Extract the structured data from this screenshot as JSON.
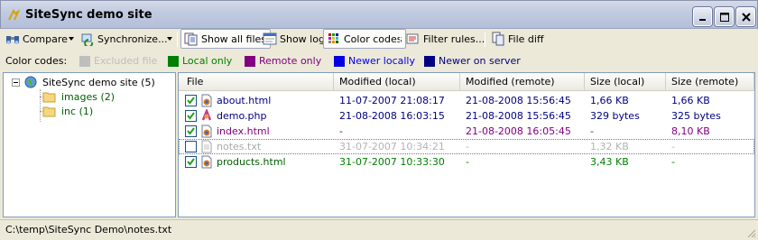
{
  "window": {
    "title": "SiteSync demo site"
  },
  "toolbar": {
    "compare": "Compare",
    "synchronize": "Synchronize...",
    "show_all_files": "Show all files",
    "show_log": "Show log",
    "color_codes": "Color codes",
    "filter_rules": "Filter rules...",
    "file_diff": "File diff"
  },
  "color_codes": {
    "label": "Color codes:",
    "items": [
      {
        "label": "Excluded file",
        "color": "#bebebe"
      },
      {
        "label": "Local only",
        "color": "#008000"
      },
      {
        "label": "Remote only",
        "color": "#800080"
      },
      {
        "label": "Newer locally",
        "color": "#0000e0"
      },
      {
        "label": "Newer on server",
        "color": "#000080"
      }
    ]
  },
  "tree": {
    "root": "SiteSync demo site (5)",
    "children": [
      "images (2)",
      "inc (1)"
    ]
  },
  "grid": {
    "columns": [
      "File",
      "Modified (local)",
      "Modified (remote)",
      "Size (local)",
      "Size (remote)"
    ],
    "rows": [
      {
        "checked": true,
        "name": "about.html",
        "icon": "html-file-icon",
        "local": "11-07-2007 21:08:17",
        "remote": "21-08-2008 15:56:45",
        "size_local": "1,66 KB",
        "size_remote": "1,66 KB",
        "name_color": "#000080",
        "color": "#000080"
      },
      {
        "checked": true,
        "name": "demo.php",
        "icon": "php-file-icon",
        "local": "21-08-2008 16:03:15",
        "remote": "21-08-2008 15:56:45",
        "size_local": "329 bytes",
        "size_remote": "325 bytes",
        "name_color": "#000080",
        "color": "#000080"
      },
      {
        "checked": true,
        "name": "index.html",
        "icon": "html-file-icon",
        "local": "-",
        "remote": "21-08-2008 16:05:45",
        "size_local": "-",
        "size_remote": "8,10 KB",
        "name_color": "#800080",
        "color": "#800080"
      },
      {
        "checked": false,
        "name": "notes.txt",
        "icon": "text-file-icon",
        "local": "31-07-2007 10:34:21",
        "remote": "-",
        "size_local": "1,32 KB",
        "size_remote": "-",
        "name_color": "#a8a8a8",
        "color": "#b4b4b4"
      },
      {
        "checked": true,
        "name": "products.html",
        "icon": "html-file-icon",
        "local": "31-07-2007 10:33:30",
        "remote": "-",
        "size_local": "3,43 KB",
        "size_remote": "-",
        "name_color": "#006000",
        "color": "#008000"
      }
    ]
  },
  "status": {
    "path": "C:\\temp\\SiteSync Demo\\notes.txt"
  }
}
